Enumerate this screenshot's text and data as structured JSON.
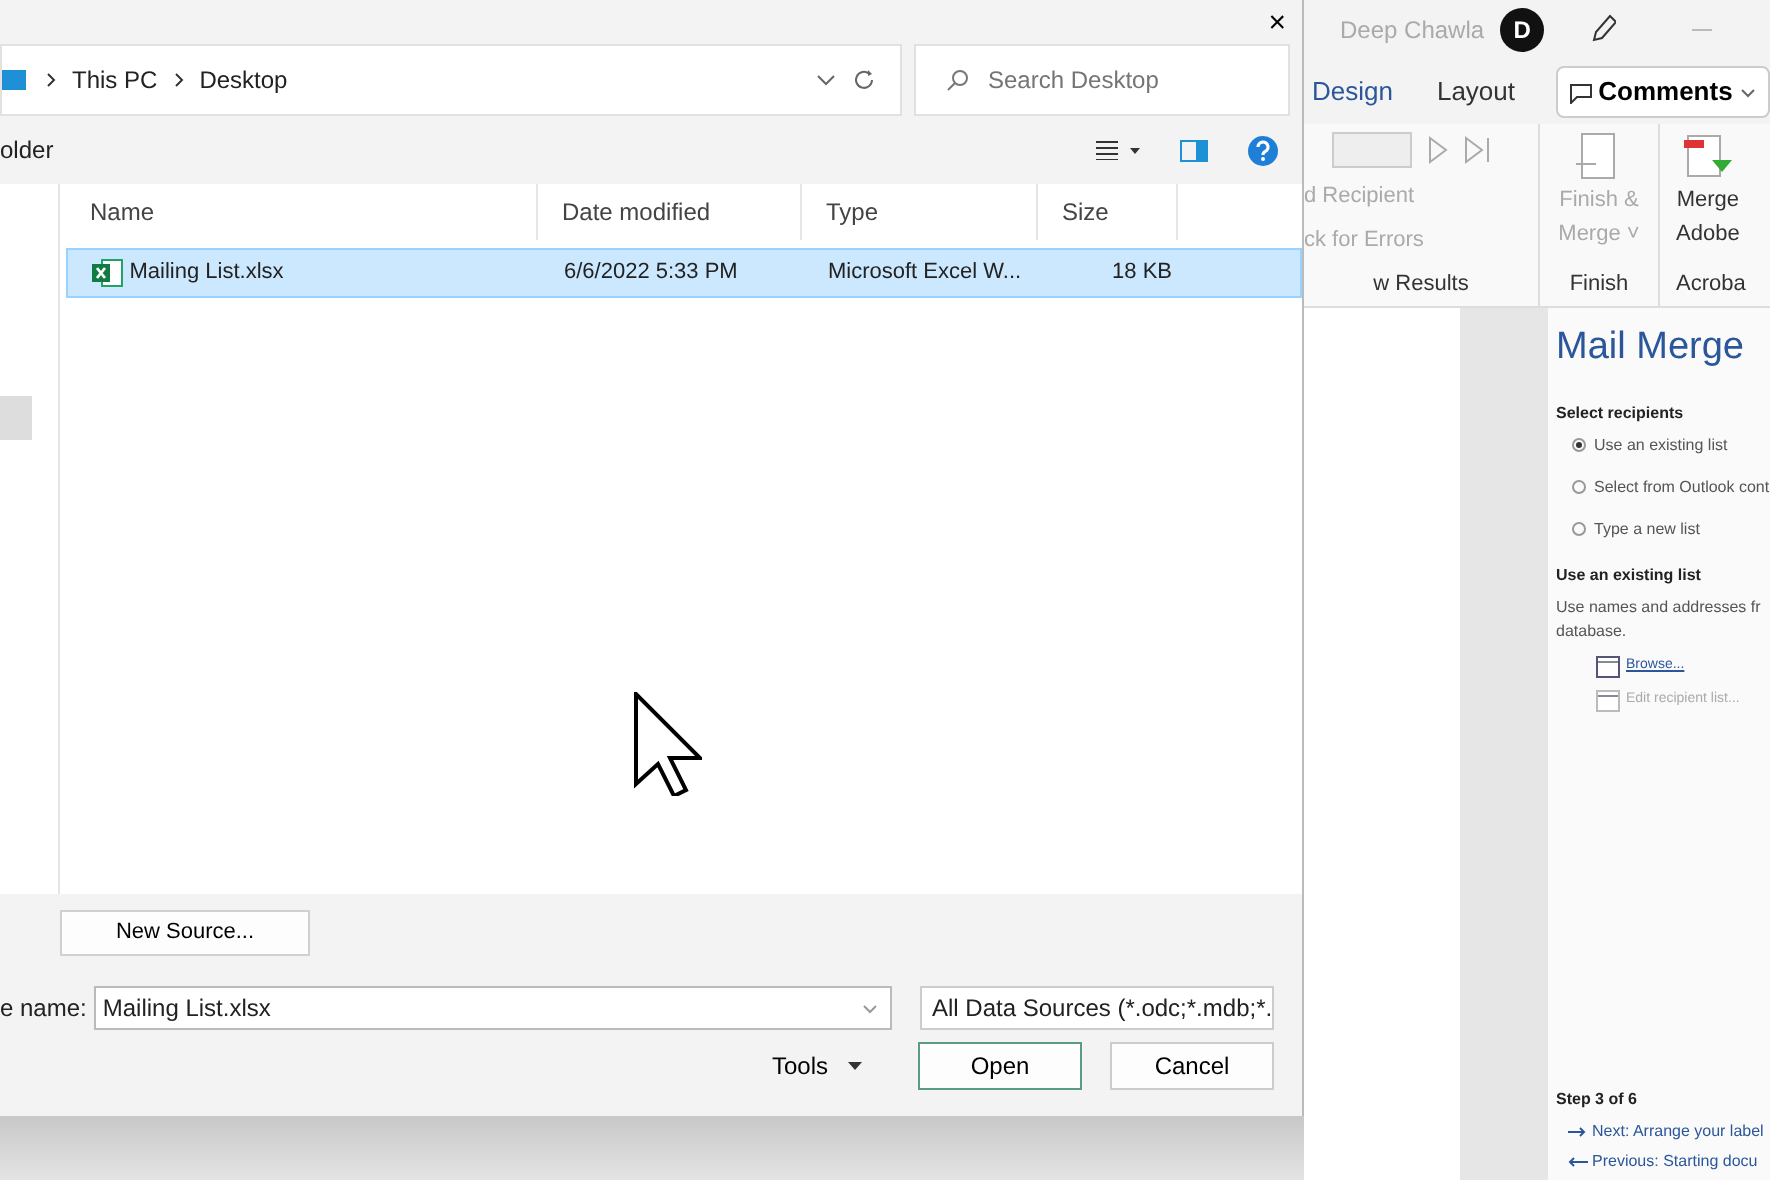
{
  "dialog": {
    "close": "×",
    "breadcrumb": [
      "This PC",
      "Desktop"
    ],
    "search": {
      "placeholder": "Search Desktop"
    },
    "toolbar_label": "older",
    "columns": [
      "Name",
      "Date modified",
      "Type",
      "Size"
    ],
    "rows": [
      {
        "name": "Mailing List.xlsx",
        "date": "6/6/2022 5:33 PM",
        "type": "Microsoft Excel W...",
        "size": "18 KB",
        "selected": true
      }
    ],
    "new_source": "New Source...",
    "file_name_label": "e name:",
    "file_name": "Mailing List.xlsx",
    "file_type": "All Data Sources (*.odc;*.mdb;*.",
    "buttons": [
      {
        "label": "Tools",
        "kind": "menu"
      },
      {
        "label": "Open",
        "kind": "default"
      },
      {
        "label": "Cancel",
        "kind": "plain"
      }
    ]
  },
  "word": {
    "user": "Deep Chawla",
    "avatar": "D",
    "tabs": [
      "Design",
      "Layout"
    ],
    "comments": "Comments",
    "ribbon_texts": [
      "d Recipient",
      "ck for Errors"
    ],
    "group_labels": [
      "w Results",
      "Finish",
      "Acroba"
    ],
    "finish_button": [
      "Finish &",
      "Merge ˅"
    ],
    "merge_button": [
      "Merge",
      "Adobe"
    ]
  },
  "pane": {
    "title": "Mail Merge",
    "section1": "Select recipients",
    "options": [
      {
        "label": "Use an existing list",
        "selected": true
      },
      {
        "label": "Select from Outlook cont",
        "selected": false
      },
      {
        "label": "Type a new list",
        "selected": false
      }
    ],
    "section2": "Use an existing list",
    "description": "Use names and addresses fr database.",
    "links": [
      {
        "label": "Browse...",
        "disabled": false
      },
      {
        "label": "Edit recipient list...",
        "disabled": true
      }
    ],
    "step": "Step 3 of 6",
    "next": "Next: Arrange your label",
    "previous": "Previous: Starting docu"
  }
}
